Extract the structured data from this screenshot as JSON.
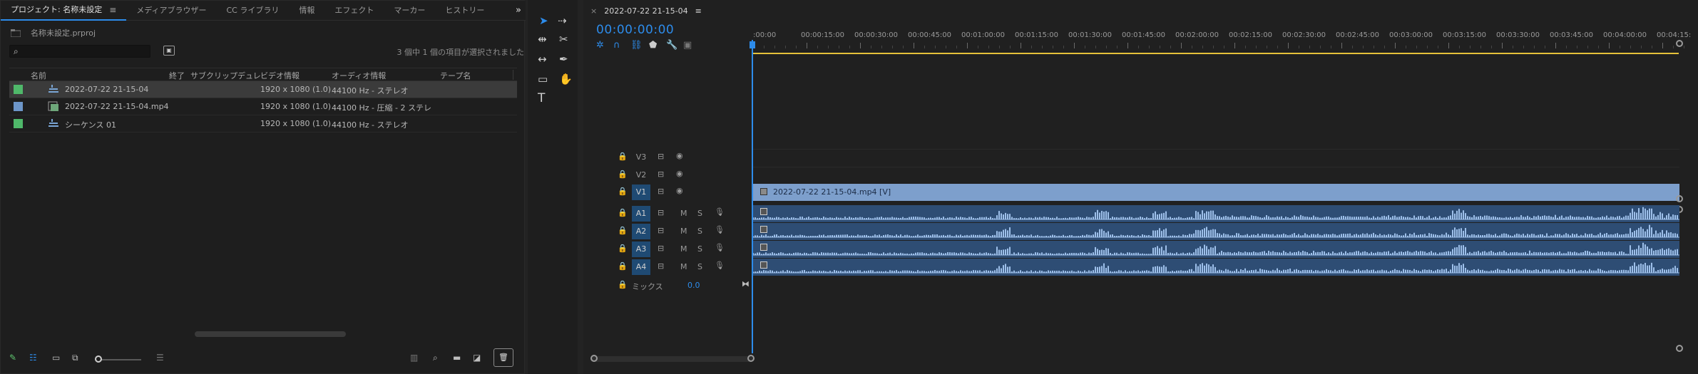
{
  "project": {
    "tabs": [
      "プロジェクト: 名称未設定",
      "メディアブラウザー",
      "CC ライブラリ",
      "情報",
      "エフェクト",
      "マーカー",
      "ヒストリー"
    ],
    "more": "»",
    "path": "名称未設定.prproj",
    "selection_info": "3 個中 1 個の項目が選択されました",
    "columns": [
      "名前",
      "終了",
      "サブクリップデュレ",
      "ビデオ情報",
      "オーディオ情報",
      "テープ名"
    ],
    "items": [
      {
        "name": "2022-07-22 21-15-04",
        "video": "1920 x 1080 (1.0)",
        "audio": "44100  Hz - ステレオ",
        "color": "#4fb86a",
        "selected": true
      },
      {
        "name": "2022-07-22 21-15-04.mp4",
        "video": "1920 x 1080 (1.0)",
        "audio": "44100  Hz - 圧縮 - 2 ステレ",
        "color": "#6d96c9",
        "selected": false
      },
      {
        "name": "シーケンス 01",
        "video": "1920 x 1080 (1.0)",
        "audio": "44100  Hz - ステレオ",
        "color": "#4fb86a",
        "selected": false
      }
    ]
  },
  "timeline": {
    "tab": "2022-07-22 21-15-04",
    "timecode": "00:00:00:00",
    "ruler": [
      ":00:00",
      "00:00:15:00",
      "00:00:30:00",
      "00:00:45:00",
      "00:01:00:00",
      "00:01:15:00",
      "00:01:30:00",
      "00:01:45:00",
      "00:02:00:00",
      "00:02:15:00",
      "00:02:30:00",
      "00:02:45:00",
      "00:03:00:00",
      "00:03:15:00",
      "00:03:30:00",
      "00:03:45:00",
      "00:04:00:00",
      "00:04:15:"
    ],
    "video_tracks": [
      "V3",
      "V2",
      "V1"
    ],
    "audio_tracks": [
      "A1",
      "A2",
      "A3",
      "A4"
    ],
    "audio_m": "M",
    "audio_s": "S",
    "video_clip": "2022-07-22 21-15-04.mp4 [V]",
    "mix_label": "ミックス",
    "mix_value": "0.0",
    "accent": "#2d8ceb",
    "video_clip_color": "#7d9fcc",
    "audio_clip_color": "#2e4d74"
  }
}
